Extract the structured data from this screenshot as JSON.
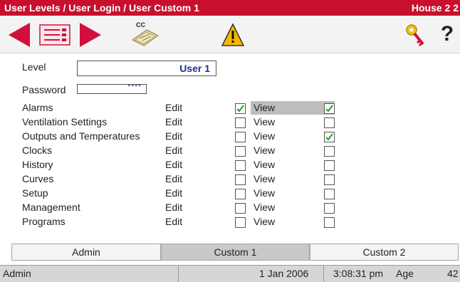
{
  "title": {
    "left": "User Levels / User Login / User Custom 1",
    "right": "House 2 2"
  },
  "toolbar": {
    "prev": "arrow-left-icon",
    "list": "list-icon",
    "next": "arrow-right-icon",
    "cc_label": "CC",
    "warning": "warning-icon",
    "key": "key-icon",
    "help": "?"
  },
  "form": {
    "level_label": "Level",
    "level_value": "User 1",
    "password_label": "Password",
    "password_value": "****"
  },
  "permissions": {
    "edit_label": "Edit",
    "view_label": "View",
    "rows": [
      {
        "name": "Alarms",
        "edit": true,
        "view": true
      },
      {
        "name": "Ventilation Settings",
        "edit": false,
        "view": false
      },
      {
        "name": "Outputs and Temperatures",
        "edit": false,
        "view": true
      },
      {
        "name": "Clocks",
        "edit": false,
        "view": false
      },
      {
        "name": "History",
        "edit": false,
        "view": false
      },
      {
        "name": "Curves",
        "edit": false,
        "view": false
      },
      {
        "name": "Setup",
        "edit": false,
        "view": false
      },
      {
        "name": "Management",
        "edit": false,
        "view": false
      },
      {
        "name": "Programs",
        "edit": false,
        "view": false
      }
    ]
  },
  "tabs": [
    {
      "label": "Admin",
      "active": false
    },
    {
      "label": "Custom 1",
      "active": true
    },
    {
      "label": "Custom 2",
      "active": false
    }
  ],
  "status": {
    "user": "Admin",
    "date": "1 Jan 2006",
    "time": "3:08:31 pm",
    "age_label": "Age",
    "age_value": "42"
  },
  "colors": {
    "title_bar": "#c8102e",
    "arrow": "#d0103a",
    "warning": "#f5b800",
    "level_text": "#1f2f8f"
  }
}
